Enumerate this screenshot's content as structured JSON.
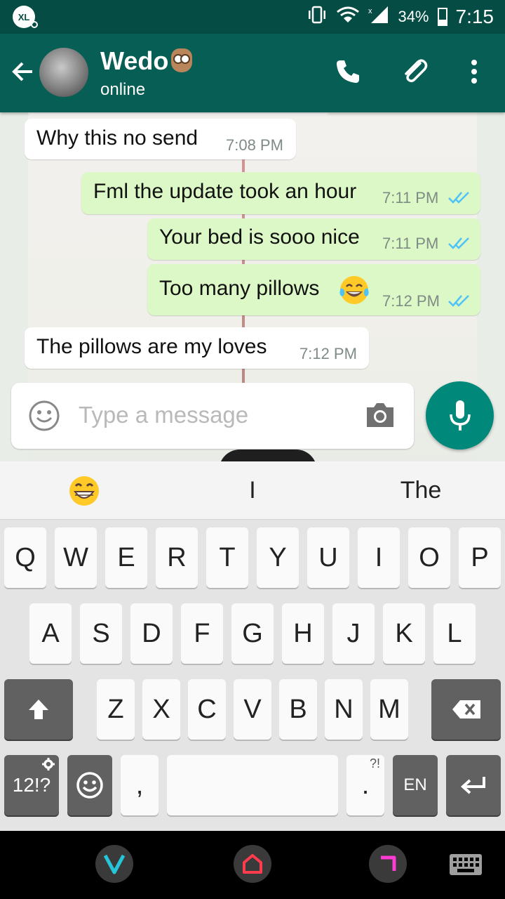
{
  "status_bar": {
    "carrier_logo": "XL",
    "battery": "34%",
    "time": "7:15",
    "icons": [
      "vibrate-icon",
      "wifi-icon",
      "signal-icon",
      "battery-icon"
    ]
  },
  "header": {
    "contact_name": "Wedo",
    "contact_emoji": "owl",
    "status": "online",
    "icons": [
      "back-arrow-icon",
      "phone-icon",
      "paperclip-icon",
      "more-vert-icon"
    ]
  },
  "messages": [
    {
      "direction": "in",
      "text": "Why this no send",
      "time": "7:08 PM"
    },
    {
      "direction": "out",
      "text": "Fml the update took an hour",
      "time": "7:11 PM",
      "read": true
    },
    {
      "direction": "out",
      "text": "Your bed is sooo nice",
      "time": "7:11 PM",
      "read": true
    },
    {
      "direction": "out",
      "text": "Too many pillows",
      "emoji": "tears-of-joy",
      "time": "7:12 PM",
      "read": true
    },
    {
      "direction": "in",
      "text": "The pillows are my loves",
      "time": "7:12 PM"
    }
  ],
  "composer": {
    "placeholder": "Type a message",
    "value": ""
  },
  "suggestions": {
    "emoji": "grinning-face",
    "word1": "I",
    "word2": "The"
  },
  "keyboard": {
    "row1": [
      "Q",
      "W",
      "E",
      "R",
      "T",
      "Y",
      "U",
      "I",
      "O",
      "P"
    ],
    "row2": [
      "A",
      "S",
      "D",
      "F",
      "G",
      "H",
      "J",
      "K",
      "L"
    ],
    "row3": [
      "Z",
      "X",
      "C",
      "V",
      "B",
      "N",
      "M"
    ],
    "symbols": "12!?",
    "comma": ",",
    "period": ".",
    "period_hint": "?!",
    "language": "EN"
  },
  "colors": {
    "header": "#075e54",
    "status_bar": "#054d44",
    "outgoing_bubble": "#dcf8c6",
    "incoming_bubble": "#ffffff",
    "mic_button": "#00897b",
    "read_ticks": "#4fc3f7"
  }
}
